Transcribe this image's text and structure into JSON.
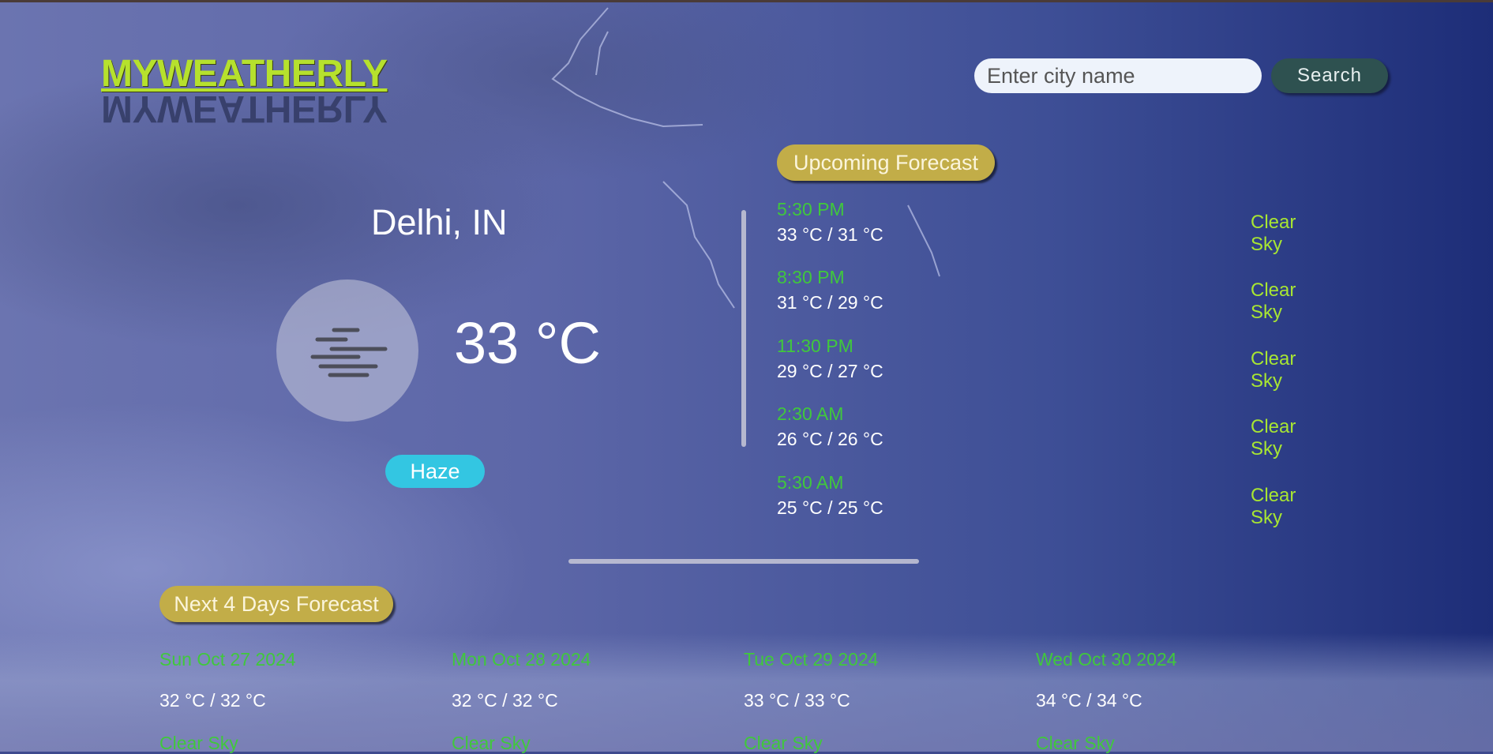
{
  "header": {
    "logo_text": "MYWEATHERLY",
    "search_placeholder": "Enter city name",
    "search_button_label": "Search"
  },
  "current": {
    "city": "Delhi, IN",
    "temperature": "33 °C",
    "condition": "Haze",
    "icon": "haze-icon"
  },
  "upcoming": {
    "title": "Upcoming Forecast",
    "items": [
      {
        "time": "5:30 PM",
        "temps": "33 °C / 31 °C",
        "desc": "Clear Sky"
      },
      {
        "time": "8:30 PM",
        "temps": "31 °C / 29 °C",
        "desc": "Clear Sky"
      },
      {
        "time": "11:30 PM",
        "temps": "29 °C / 27 °C",
        "desc": "Clear Sky"
      },
      {
        "time": "2:30 AM",
        "temps": "26 °C / 26 °C",
        "desc": "Clear Sky"
      },
      {
        "time": "5:30 AM",
        "temps": "25 °C / 25 °C",
        "desc": "Clear Sky"
      }
    ]
  },
  "daily": {
    "title": "Next 4 Days Forecast",
    "items": [
      {
        "date": "Sun Oct 27 2024",
        "temps": "32 °C / 32 °C",
        "desc": "Clear Sky"
      },
      {
        "date": "Mon Oct 28 2024",
        "temps": "32 °C / 32 °C",
        "desc": "Clear Sky"
      },
      {
        "date": "Tue Oct 29 2024",
        "temps": "33 °C / 33 °C",
        "desc": "Clear Sky"
      },
      {
        "date": "Wed Oct 30 2024",
        "temps": "34 °C / 34 °C",
        "desc": "Clear Sky"
      }
    ]
  },
  "colors": {
    "logo": "#b6e12d",
    "accent_pill": "#c2ad48",
    "search_button": "#2e5150",
    "condition_badge": "#33c6e2",
    "time_text": "#40c83c",
    "desc_text": "#a8e632"
  }
}
